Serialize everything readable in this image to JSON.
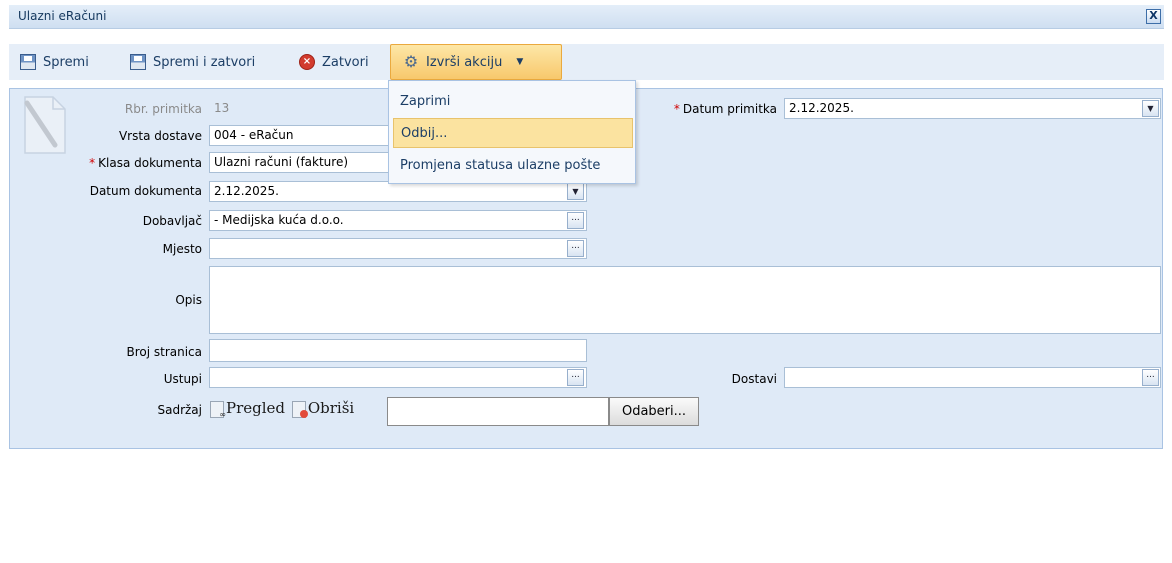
{
  "window": {
    "title": "Ulazni eRačuni",
    "close_label": "X"
  },
  "toolbar": {
    "save": "Spremi",
    "save_close": "Spremi i zatvori",
    "close": "Zatvori",
    "action": "Izvrši akciju"
  },
  "action_menu": {
    "items": [
      "Zaprimi",
      "Odbij...",
      "Promjena statusa ulazne pošte"
    ],
    "highlighted": "Odbij..."
  },
  "form": {
    "rbr_label": "Rbr. primitka",
    "rbr_value": "13",
    "vrsta_label": "Vrsta dostave",
    "vrsta_value": "004 - eRačun",
    "klasa_label": "Klasa dokumenta",
    "klasa_value": "Ulazni računi (fakture)",
    "datum_dok_label": "Datum dokumenta",
    "datum_dok_value": "2.12.2025.",
    "dobavljac_label": "Dobavljač",
    "dobavljac_value": "- Medijska kuća d.o.o.",
    "mjesto_label": "Mjesto",
    "mjesto_value": "",
    "opis_label": "Opis",
    "opis_value": "",
    "broj_label": "Broj stranica",
    "broj_value": "",
    "ustupi_label": "Ustupi",
    "ustupi_value": "",
    "dostavi_label": "Dostavi",
    "dostavi_value": "",
    "datum_prim_label": "Datum primitka",
    "datum_prim_value": "2.12.2025.",
    "sadrzaj_label": "Sadržaj",
    "pregled": "Pregled",
    "obrisi": "Obriši",
    "file_value": "",
    "odaberi": "Odaberi...",
    "required_mark": "*",
    "ellipsis": "...",
    "dropdown_arrow": "▼"
  }
}
